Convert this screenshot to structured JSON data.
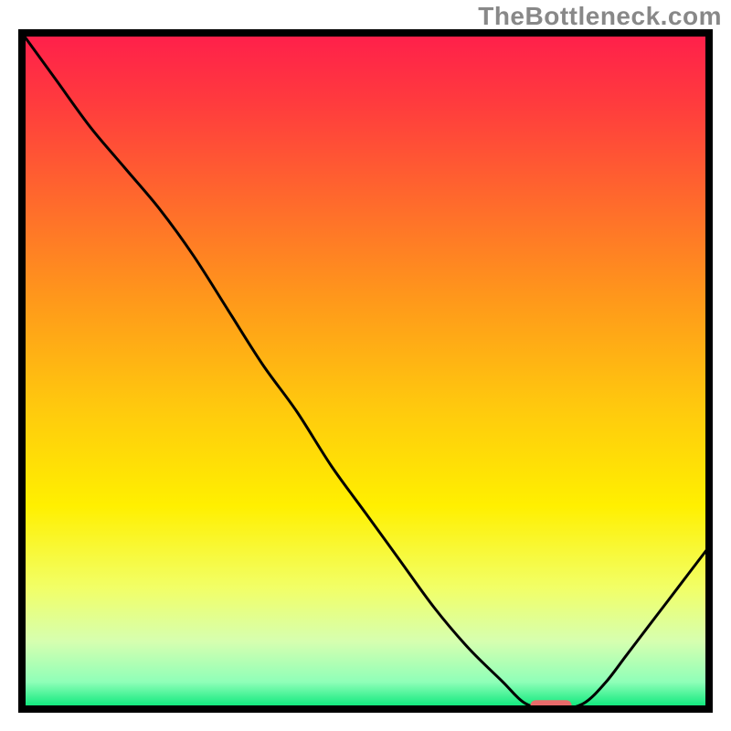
{
  "watermark": "TheBottleneck.com",
  "chart_data": {
    "type": "line",
    "title": "",
    "xlabel": "",
    "ylabel": "",
    "xlim": [
      0,
      100
    ],
    "ylim": [
      0,
      100
    ],
    "grid": false,
    "legend": false,
    "series": [
      {
        "name": "curve",
        "x": [
          0,
          5,
          10,
          15,
          20,
          25,
          30,
          35,
          40,
          45,
          50,
          55,
          60,
          65,
          70,
          73,
          76,
          79,
          82,
          85,
          88,
          91,
          94,
          97,
          100
        ],
        "y": [
          100,
          93,
          86,
          80,
          74,
          67,
          59,
          51,
          44,
          36,
          29,
          22,
          15,
          9,
          4,
          1,
          0,
          0,
          1,
          4,
          8,
          12,
          16,
          20,
          24
        ]
      }
    ],
    "marker": {
      "x_start": 74,
      "x_end": 80,
      "y": 0.5
    },
    "gradient_stops": [
      {
        "offset": 0.0,
        "color": "#ff1f4b"
      },
      {
        "offset": 0.1,
        "color": "#ff3a3e"
      },
      {
        "offset": 0.25,
        "color": "#ff6a2c"
      },
      {
        "offset": 0.4,
        "color": "#ff9a1a"
      },
      {
        "offset": 0.55,
        "color": "#ffc80e"
      },
      {
        "offset": 0.7,
        "color": "#fff000"
      },
      {
        "offset": 0.82,
        "color": "#f2ff66"
      },
      {
        "offset": 0.9,
        "color": "#d6ffb0"
      },
      {
        "offset": 0.96,
        "color": "#8fffb8"
      },
      {
        "offset": 1.0,
        "color": "#00e676"
      }
    ],
    "frame_color": "#000000",
    "curve_color": "#000000",
    "marker_color": "#e86a6a"
  }
}
